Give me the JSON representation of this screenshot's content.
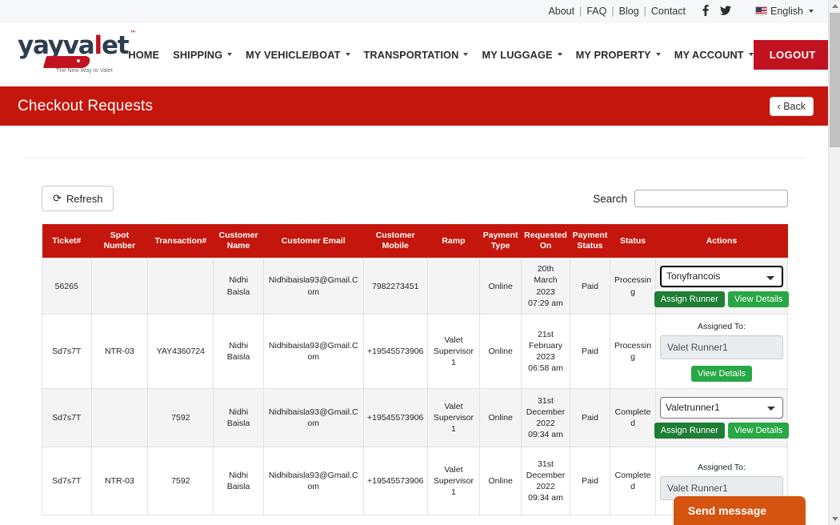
{
  "topbar": {
    "links": [
      {
        "label": "About"
      },
      {
        "label": "FAQ"
      },
      {
        "label": "Blog"
      },
      {
        "label": "Contact"
      }
    ],
    "separator": "|",
    "social": [
      {
        "name": "facebook-icon",
        "glyph": "f"
      },
      {
        "name": "twitter-icon",
        "glyph": "🐦"
      }
    ],
    "language": "English"
  },
  "header": {
    "logo": {
      "text_part1": "yayva",
      "text_accent": "l",
      "text_part2": "et",
      "tm": "™",
      "slogan": "The New Way to Valet"
    },
    "nav": [
      {
        "label": "HOME",
        "has_caret": false
      },
      {
        "label": "SHIPPING",
        "has_caret": true
      },
      {
        "label": "MY VEHICLE/BOAT",
        "has_caret": true
      },
      {
        "label": "TRANSPORTATION",
        "has_caret": true
      },
      {
        "label": "MY LUGGAGE",
        "has_caret": true
      },
      {
        "label": "MY PROPERTY",
        "has_caret": true
      },
      {
        "label": "MY ACCOUNT",
        "has_caret": true
      }
    ],
    "logout_label": "LOGOUT"
  },
  "title_band": {
    "title": "Checkout Requests",
    "back_label": "‹ Back"
  },
  "toolbar": {
    "refresh_label": "Refresh",
    "refresh_icon": "⟳",
    "search_label": "Search",
    "search_value": "",
    "search_placeholder": ""
  },
  "table": {
    "headers": [
      "Ticket#",
      "Spot Number",
      "Transaction#",
      "Customer Name",
      "Customer Email",
      "Customer Mobile",
      "Ramp",
      "Payment Type",
      "Requested On",
      "Payment Status",
      "Status",
      "Actions"
    ],
    "rows": [
      {
        "ticket": "56265",
        "spot_number": "",
        "transaction": "",
        "customer_name": "Nidhi Baisla",
        "customer_email": "Nidhibaisla93@Gmail.Com",
        "customer_mobile": "7982273451",
        "ramp": "",
        "payment_type": "Online",
        "requested_on": "20th March 2023 07:29 am",
        "payment_status": "Paid",
        "status": "Processing",
        "action_mode": "select",
        "selected_runner": "Tonyfrancois",
        "runner_options": [
          "Tonyfrancois"
        ],
        "assign_label": "Assign Runner",
        "view_label": "View Details"
      },
      {
        "ticket": "Sd7s7T",
        "spot_number": "NTR-03",
        "transaction": "YAY4360724",
        "customer_name": "Nidhi Baisla",
        "customer_email": "Nidhibaisla93@Gmail.Com",
        "customer_mobile": "+19545573906",
        "ramp": "Valet Supervisor 1",
        "payment_type": "Online",
        "requested_on": "21st February 2023 06:58 am",
        "payment_status": "Paid",
        "status": "Processing",
        "action_mode": "assigned",
        "assigned_to_label": "Assigned To:",
        "assigned_runner": "Valet Runner1",
        "view_label": "View Details"
      },
      {
        "ticket": "Sd7s7T",
        "spot_number": "",
        "transaction": "7592",
        "customer_name": "Nidhi Baisla",
        "customer_email": "Nidhibaisla93@Gmail.Com",
        "customer_mobile": "+19545573906",
        "ramp": "Valet Supervisor 1",
        "payment_type": "Online",
        "requested_on": "31st December 2022 09:34 am",
        "payment_status": "Paid",
        "status": "Completed",
        "action_mode": "select",
        "selected_runner": "Valetrunner1",
        "runner_options": [
          "Valetrunner1"
        ],
        "assign_label": "Assign Runner",
        "view_label": "View Details"
      },
      {
        "ticket": "Sd7s7T",
        "spot_number": "NTR-03",
        "transaction": "7592",
        "customer_name": "Nidhi Baisla",
        "customer_email": "Nidhibaisla93@Gmail.Com",
        "customer_mobile": "+19545573906",
        "ramp": "Valet Supervisor 1",
        "payment_type": "Online",
        "requested_on": "31st December 2022 09:34 am",
        "payment_status": "Paid",
        "status": "Completed",
        "action_mode": "assigned",
        "assigned_to_label": "Assigned To:",
        "assigned_runner": "Valet Runner1",
        "view_label": ""
      }
    ]
  },
  "chat_widget": {
    "label": "Send message"
  },
  "colors": {
    "brand_red": "#c4160c",
    "logo_red": "#c1121f",
    "green_button": "#28a745",
    "chat_orange": "#d4540f"
  }
}
